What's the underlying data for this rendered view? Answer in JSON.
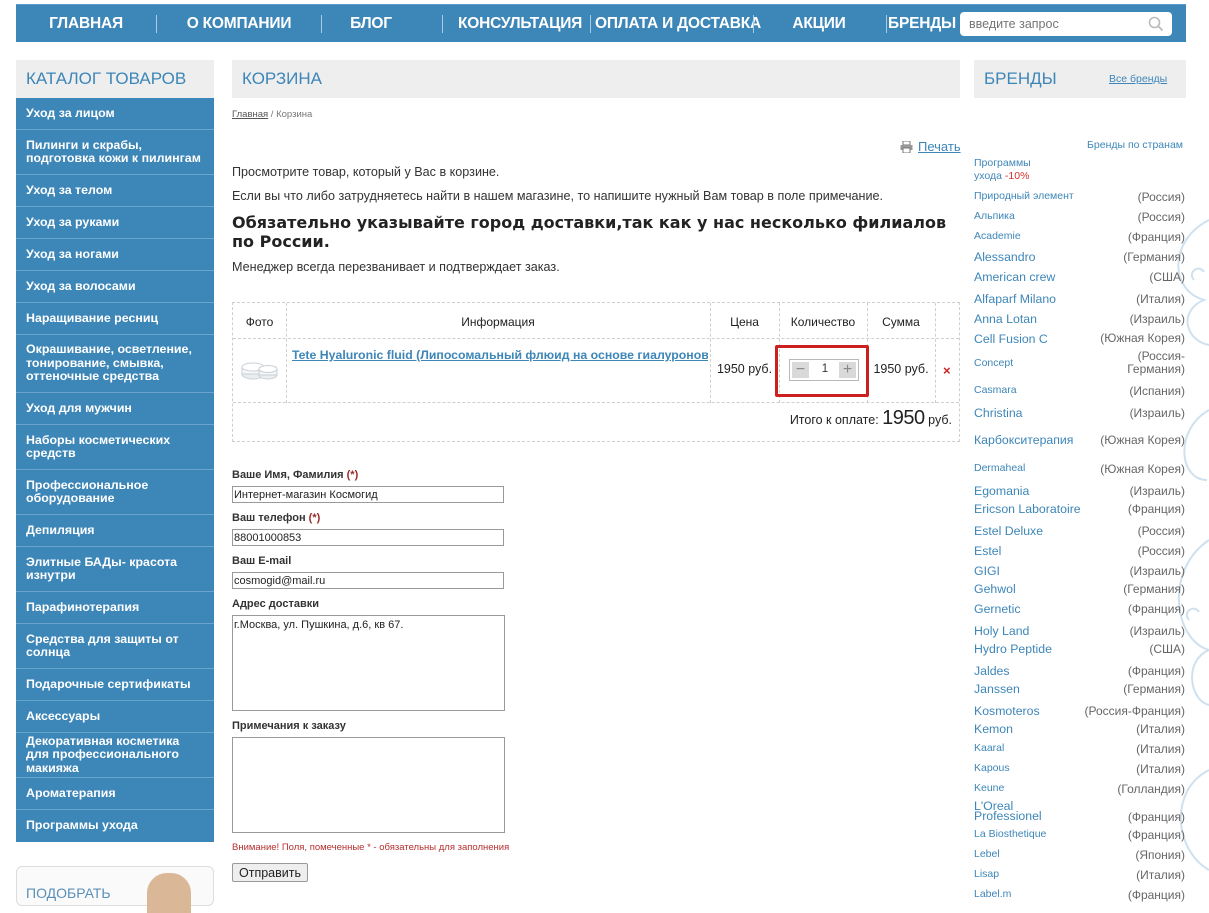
{
  "nav": {
    "items": [
      "Главная",
      "О компании",
      "Блог",
      "Консультация",
      "Оплата и доставка",
      "Акции",
      "Бренды"
    ],
    "search_placeholder": "введите запрос"
  },
  "sidebar": {
    "title": "Каталог товаров",
    "items": [
      "Уход за лицом",
      "Пилинги и скрабы, подготовка кожи к пилингам",
      "Уход за телом",
      "Уход за руками",
      "Уход за ногами",
      "Уход за волосами",
      "Наращивание ресниц",
      "Окрашивание, осветление, тонирование, смывка, оттеночные средства",
      "Уход для мужчин",
      "Наборы косметических средств",
      "Профессиональное оборудование",
      "Депиляция",
      "Элитные БАДы- красота изнутри",
      "Парафинотерапия",
      "Средства для защиты от солнца",
      "Подарочные сертификаты",
      "Аксессуары",
      "Декоративная косметика для профессионального макияжа",
      "Ароматерапия",
      "Программы ухода"
    ],
    "promo_title": "Подобрать"
  },
  "main": {
    "title": "Корзина",
    "breadcrumb": {
      "home": "Главная",
      "sep": " / ",
      "current": "Корзина"
    },
    "print_label": "Печать",
    "intro1": "Просмотрите товар, который у Вас в корзине.",
    "intro2": "Если вы что либо затрудняетесь найти в нашем магазине, то напишите нужный Вам товар в поле примечание.",
    "warning_heading": "Обязательно указывайте город доставки,так как у нас несколько филиалов по России.",
    "manager_note": "Менеджер всегда перезванивает и подтверждает  заказ."
  },
  "cart": {
    "headers": {
      "photo": "Фото",
      "info": "Информация",
      "price": "Цена",
      "qty": "Количество",
      "sum": "Сумма"
    },
    "row": {
      "name": "Tete Hyaluronic fluid (Липосомальный флюид на основе гиалуроновой кислоты)",
      "price": "1950 руб.",
      "quantity": "1",
      "sum": "1950 руб.",
      "delete_icon": "×"
    },
    "total_label": "Итого к оплате:",
    "total_value": "1950",
    "total_unit": "руб."
  },
  "form": {
    "name_label": "Ваше Имя, Фамилия",
    "name_value": "Интернет-магазин Космогид",
    "phone_label": "Ваш телефон",
    "phone_value": "88001000853",
    "email_label": "Ваш E-mail",
    "email_value": "cosmogid@mail.ru",
    "address_label": "Адрес доставки",
    "address_value": "г.Москва, ул. Пушкина, д.6, кв 67.",
    "notes_label": "Примечания к заказу",
    "notes_value": "",
    "required_mark": "(*)",
    "warning": "Внимание! Поля, помеченные * - обязательны для заполнения",
    "submit_label": "Отправить"
  },
  "brands": {
    "title": "Бренды",
    "all_link": "Все бренды",
    "by_country": "Бренды по странам",
    "programs": {
      "name": "Программы",
      "name2": "ухода",
      "discount": "-10%"
    },
    "list": [
      {
        "name": "Природный элемент",
        "country": "(Россия)"
      },
      {
        "name": "Альпика",
        "country": "(Россия)"
      },
      {
        "name": "Academie",
        "country": "(Франция)"
      },
      {
        "name": "Alessandro",
        "country": "(Германия)"
      },
      {
        "name": "American crew",
        "country": "(США)"
      },
      {
        "name": "Alfaparf Milano",
        "country": "(Италия)"
      },
      {
        "name": "Anna Lotan",
        "country": "(Израиль)"
      },
      {
        "name": "Cell Fusion C",
        "country": "(Южная Корея)"
      },
      {
        "name": "Concept",
        "country": "(Россия-Германия)"
      },
      {
        "name": "Casmara",
        "country": "(Испания)"
      },
      {
        "name": "Christina",
        "country": "(Израиль)"
      },
      {
        "name": "Карбокситерапия",
        "country": "(Южная Корея)"
      },
      {
        "name": "Dermaheal",
        "country": "(Южная Корея)"
      },
      {
        "name": "Egomania",
        "country": "(Израиль)"
      },
      {
        "name": "Ericson Laboratoire",
        "country": "(Франция)"
      },
      {
        "name": "Estel Deluxe",
        "country": "(Россия)"
      },
      {
        "name": "Estel",
        "country": "(Россия)"
      },
      {
        "name": "GIGI",
        "country": "(Израиль)"
      },
      {
        "name": "Gehwol",
        "country": "(Германия)"
      },
      {
        "name": "Gernetic",
        "country": "(Франция)"
      },
      {
        "name": "Holy Land",
        "country": "(Израиль)"
      },
      {
        "name": "Hydro Peptide",
        "country": "(США)"
      },
      {
        "name": "Jaldes",
        "country": "(Франция)"
      },
      {
        "name": "Janssen",
        "country": "(Германия)"
      },
      {
        "name": "Kosmoteros",
        "country": "(Россия-Франция)"
      },
      {
        "name": "Kemon",
        "country": "(Италия)"
      },
      {
        "name": "Kaaral",
        "country": "(Италия)"
      },
      {
        "name": "Kapous",
        "country": "(Италия)"
      },
      {
        "name": "Keune",
        "country": "(Голландия)"
      },
      {
        "name": "L'Oreal Professionel",
        "country": "(Франция)"
      },
      {
        "name": "La Biosthetique",
        "country": "(Франция)"
      },
      {
        "name": "Lebel",
        "country": "(Япония)"
      },
      {
        "name": "Lisap",
        "country": "(Италия)"
      },
      {
        "name": "Label.m",
        "country": "(Франция)"
      }
    ]
  }
}
